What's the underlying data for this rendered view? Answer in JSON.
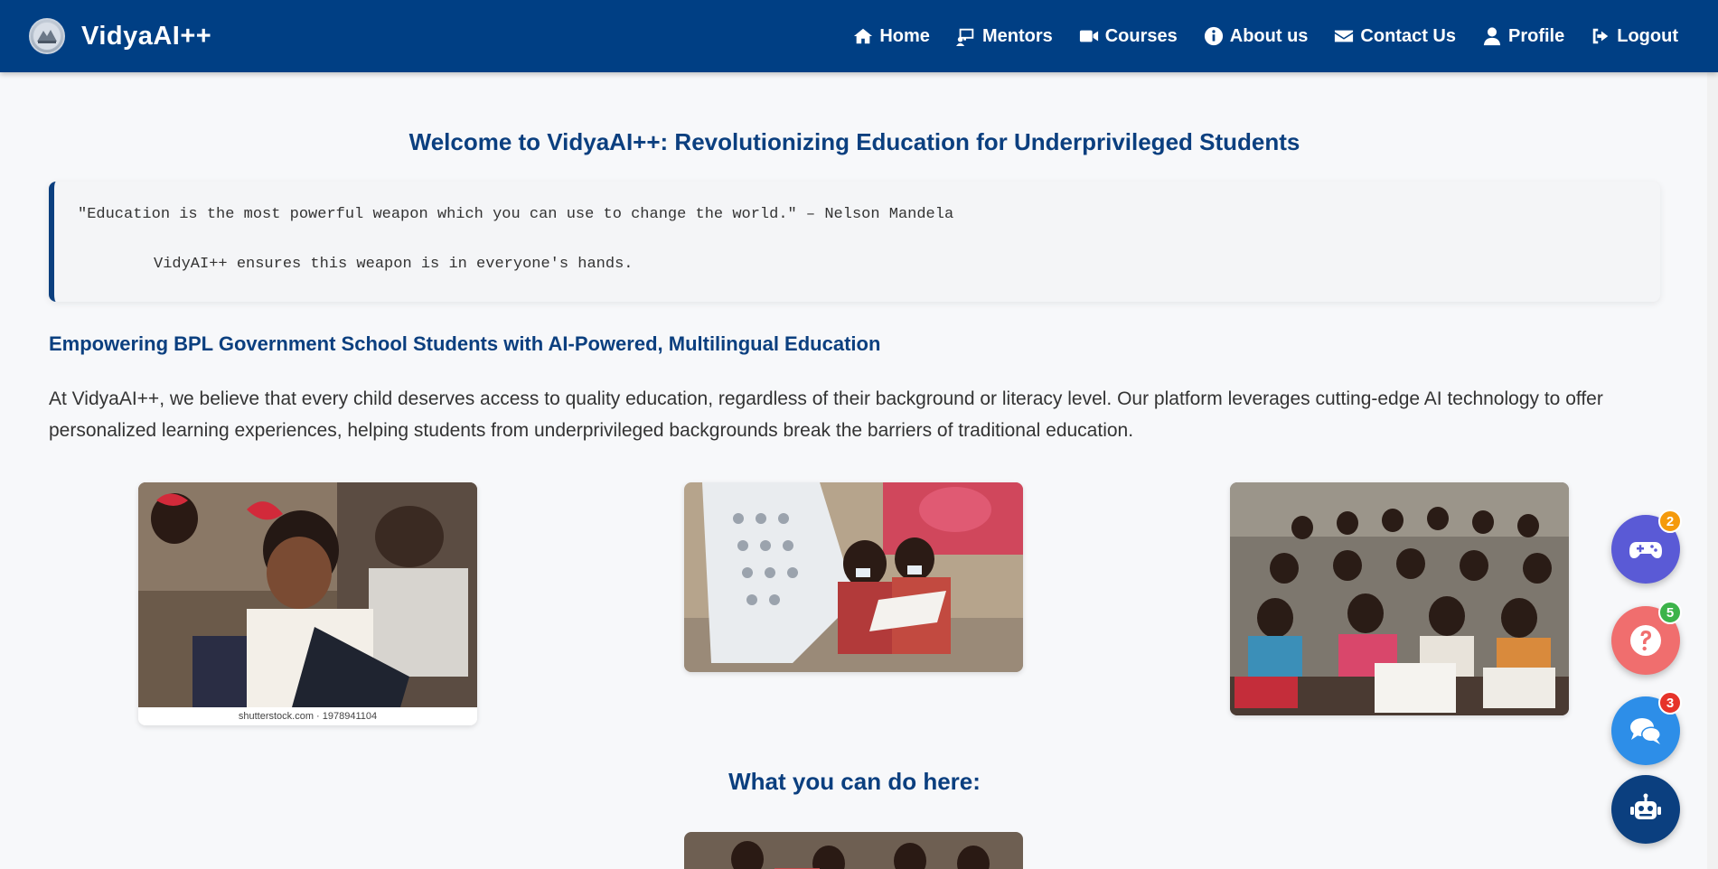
{
  "app": {
    "brand_name": "VidyaAI++",
    "logo_icon": "logo-icon"
  },
  "nav": {
    "items": [
      {
        "label": "Home",
        "icon": "home-icon"
      },
      {
        "label": "Mentors",
        "icon": "mentor-icon"
      },
      {
        "label": "Courses",
        "icon": "video-icon"
      },
      {
        "label": "About us",
        "icon": "info-icon"
      },
      {
        "label": "Contact Us",
        "icon": "envelope-icon"
      },
      {
        "label": "Profile",
        "icon": "user-icon"
      },
      {
        "label": "Logout",
        "icon": "logout-icon"
      }
    ]
  },
  "main": {
    "title": "Welcome to VidyaAI++: Revolutionizing Education for Underprivileged Students",
    "quote": {
      "line1": "\"Education is the most powerful weapon which you can use to change the world.\" – Nelson Mandela",
      "line2": "VidyAI++ ensures this weapon is in everyone's hands."
    },
    "subheading": "Empowering BPL Government School Students with AI-Powered, Multilingual Education",
    "intro": "At VidyaAI++, we believe that every child deserves access to quality education, regardless of their background or literacy level. Our platform leverages cutting-edge AI technology to offer personalized learning experiences, helping students from underprivileged backgrounds break the barriers of traditional education.",
    "gallery": {
      "photo1_watermark": "shutterstock.com · 1978941104"
    },
    "section_title": "What you can do here:"
  },
  "floating": {
    "game": {
      "icon": "gamepad-icon",
      "badge": "2",
      "color": "#5a5ad6"
    },
    "help": {
      "icon": "question-icon",
      "badge": "5",
      "color": "#f06e6e"
    },
    "chat": {
      "icon": "chat-icon",
      "badge": "3",
      "color": "#2d8ee8"
    },
    "bot": {
      "icon": "robot-icon",
      "color": "#0b3f7f"
    }
  },
  "colors": {
    "navbar": "#003f84",
    "accent": "#0b3f7f",
    "background": "#f7f8fa"
  }
}
